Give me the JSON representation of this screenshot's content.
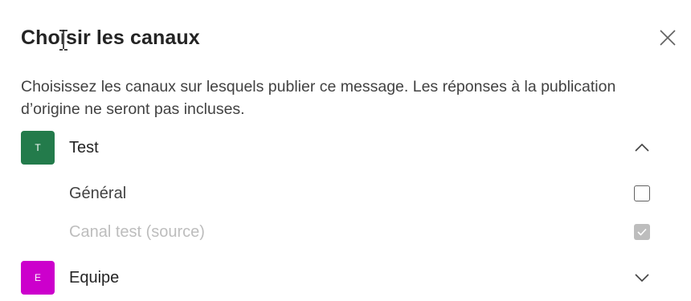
{
  "dialog": {
    "title": "Choisir les canaux",
    "description": "Choisissez les canaux sur lesquels publier ce message. Les réponses à la publication d’origine ne seront pas incluses."
  },
  "teams": [
    {
      "initial": "T",
      "name": "Test",
      "color": "#237b4b",
      "expanded": true,
      "channels": [
        {
          "name": "Général",
          "checked": false,
          "disabled": false
        },
        {
          "name": "Canal test (source)",
          "checked": true,
          "disabled": true
        }
      ]
    },
    {
      "initial": "E",
      "name": "Equipe",
      "color": "#cc00cc",
      "expanded": false,
      "channels": []
    }
  ],
  "icons": {
    "close": "close-icon",
    "collapse": "chevron-up-icon",
    "expand": "chevron-down-icon",
    "check": "checkmark-icon",
    "cursor": "text-cursor-icon"
  }
}
